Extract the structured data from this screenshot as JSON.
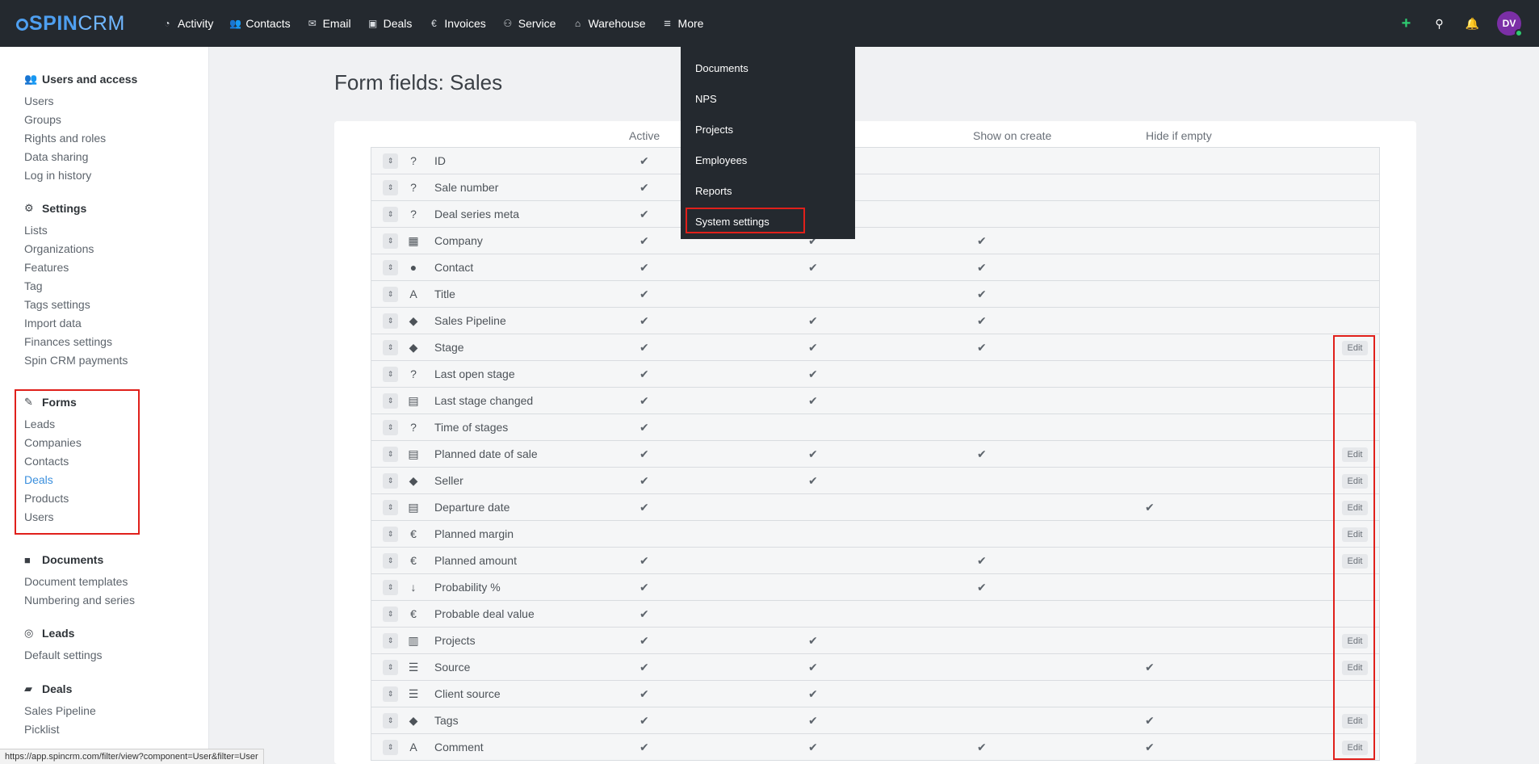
{
  "app": {
    "logo_text_a": "SPIN",
    "logo_text_b": "CRM"
  },
  "topnav": [
    {
      "label": "Activity",
      "icon": "activity-gauge-icon",
      "glyph": "◔"
    },
    {
      "label": "Contacts",
      "icon": "contacts-icon",
      "glyph": "👥"
    },
    {
      "label": "Email",
      "icon": "email-icon",
      "glyph": "✉"
    },
    {
      "label": "Deals",
      "icon": "deals-briefcase-icon",
      "glyph": "▣"
    },
    {
      "label": "Invoices",
      "icon": "euro-icon",
      "glyph": "€"
    },
    {
      "label": "Service",
      "icon": "service-icon",
      "glyph": "⚇"
    },
    {
      "label": "Warehouse",
      "icon": "warehouse-icon",
      "glyph": "⌂"
    },
    {
      "label": "More",
      "icon": "hamburger-icon",
      "glyph": "≡"
    }
  ],
  "topright": {
    "add_glyph": "+",
    "search_glyph": "⚲",
    "bell_glyph": "🔔",
    "avatar_initials": "DV"
  },
  "dropdown": [
    "Documents",
    "NPS",
    "Projects",
    "Employees",
    "Reports",
    "System settings"
  ],
  "sidebar": {
    "users_access": {
      "title": "Users and access",
      "items": [
        "Users",
        "Groups",
        "Rights and roles",
        "Data sharing",
        "Log in history"
      ]
    },
    "settings": {
      "title": "Settings",
      "items": [
        "Lists",
        "Organizations",
        "Features",
        "Tag",
        "Tags settings",
        "Import data",
        "Finances settings",
        "Spin CRM payments"
      ]
    },
    "forms": {
      "title": "Forms",
      "items": [
        "Leads",
        "Companies",
        "Contacts",
        "Deals",
        "Products",
        "Users"
      ],
      "active": "Deals"
    },
    "documents": {
      "title": "Documents",
      "items": [
        "Document templates",
        "Numbering and series"
      ]
    },
    "leads": {
      "title": "Leads",
      "items": [
        "Default settings"
      ]
    },
    "deals": {
      "title": "Deals",
      "items": [
        "Sales Pipeline",
        "Picklist"
      ]
    }
  },
  "main": {
    "title": "Form fields: Sales",
    "columns": {
      "active": "Active",
      "show_on_create": "Show on create",
      "hide_if_empty": "Hide if empty"
    },
    "check_glyph": "✔",
    "edit_label": "Edit",
    "rows": [
      {
        "name": "ID",
        "icon": "question-icon",
        "glyph": "?",
        "c1": true,
        "c2": false,
        "c3": false,
        "c4": false,
        "edit": false
      },
      {
        "name": "Sale number",
        "icon": "question-icon",
        "glyph": "?",
        "c1": true,
        "c2": false,
        "c3": false,
        "c4": false,
        "edit": false
      },
      {
        "name": "Deal series meta",
        "icon": "question-icon",
        "glyph": "?",
        "c1": true,
        "c2": false,
        "c3": false,
        "c4": false,
        "edit": false
      },
      {
        "name": "Company",
        "icon": "building-icon",
        "glyph": "▦",
        "c1": true,
        "c2": true,
        "c3": true,
        "c4": false,
        "edit": false
      },
      {
        "name": "Contact",
        "icon": "user-icon",
        "glyph": "●",
        "c1": true,
        "c2": true,
        "c3": true,
        "c4": false,
        "edit": false
      },
      {
        "name": "Title",
        "icon": "text-a-icon",
        "glyph": "A",
        "c1": true,
        "c2": false,
        "c3": true,
        "c4": false,
        "edit": false
      },
      {
        "name": "Sales Pipeline",
        "icon": "tag-icon",
        "glyph": "◆",
        "c1": true,
        "c2": true,
        "c3": true,
        "c4": false,
        "edit": false
      },
      {
        "name": "Stage",
        "icon": "tag-icon",
        "glyph": "◆",
        "c1": true,
        "c2": true,
        "c3": true,
        "c4": false,
        "edit": true
      },
      {
        "name": "Last open stage",
        "icon": "question-icon",
        "glyph": "?",
        "c1": true,
        "c2": true,
        "c3": false,
        "c4": false,
        "edit": false
      },
      {
        "name": "Last stage changed",
        "icon": "calendar-icon",
        "glyph": "▤",
        "c1": true,
        "c2": true,
        "c3": false,
        "c4": false,
        "edit": false
      },
      {
        "name": "Time of stages",
        "icon": "question-icon",
        "glyph": "?",
        "c1": true,
        "c2": false,
        "c3": false,
        "c4": false,
        "edit": false
      },
      {
        "name": "Planned date of sale",
        "icon": "calendar-icon",
        "glyph": "▤",
        "c1": true,
        "c2": true,
        "c3": true,
        "c4": false,
        "edit": true
      },
      {
        "name": "Seller",
        "icon": "tag-icon",
        "glyph": "◆",
        "c1": true,
        "c2": true,
        "c3": false,
        "c4": false,
        "edit": true
      },
      {
        "name": "Departure date",
        "icon": "calendar-icon",
        "glyph": "▤",
        "c1": true,
        "c2": false,
        "c3": false,
        "c4": true,
        "edit": true
      },
      {
        "name": "Planned margin",
        "icon": "euro-icon",
        "glyph": "€",
        "c1": false,
        "c2": false,
        "c3": false,
        "c4": false,
        "edit": true
      },
      {
        "name": "Planned amount",
        "icon": "euro-icon",
        "glyph": "€",
        "c1": true,
        "c2": false,
        "c3": true,
        "c4": false,
        "edit": true
      },
      {
        "name": "Probability %",
        "icon": "sort-numeric-icon",
        "glyph": "↓",
        "c1": true,
        "c2": false,
        "c3": true,
        "c4": false,
        "edit": false
      },
      {
        "name": "Probable deal value",
        "icon": "euro-icon",
        "glyph": "€",
        "c1": true,
        "c2": false,
        "c3": false,
        "c4": false,
        "edit": false
      },
      {
        "name": "Projects",
        "icon": "clipboard-icon",
        "glyph": "▥",
        "c1": true,
        "c2": true,
        "c3": false,
        "c4": false,
        "edit": true
      },
      {
        "name": "Source",
        "icon": "list-icon",
        "glyph": "☰",
        "c1": true,
        "c2": true,
        "c3": false,
        "c4": true,
        "edit": true
      },
      {
        "name": "Client source",
        "icon": "list-icon",
        "glyph": "☰",
        "c1": true,
        "c2": true,
        "c3": false,
        "c4": false,
        "edit": false
      },
      {
        "name": "Tags",
        "icon": "tag-icon",
        "glyph": "◆",
        "c1": true,
        "c2": true,
        "c3": false,
        "c4": true,
        "edit": true
      },
      {
        "name": "Comment",
        "icon": "text-a-icon",
        "glyph": "A",
        "c1": true,
        "c2": true,
        "c3": true,
        "c4": true,
        "edit": true
      }
    ]
  },
  "status_url": "https://app.spincrm.com/filter/view?component=User&filter=User"
}
